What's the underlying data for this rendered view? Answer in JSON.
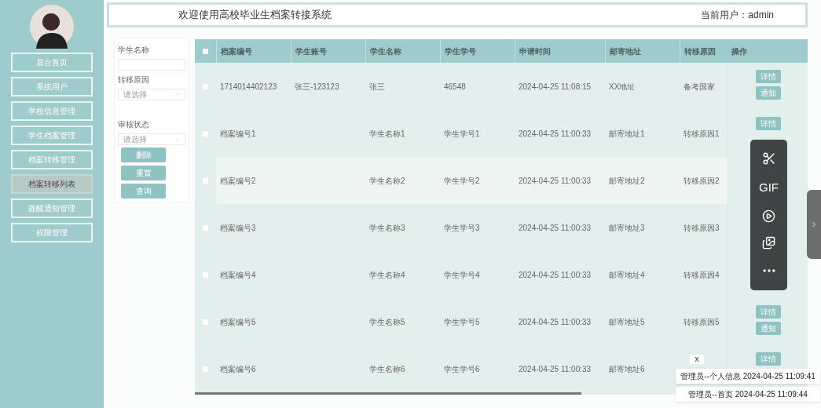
{
  "sidebar": {
    "items": [
      {
        "label": "后台首页",
        "selected": false
      },
      {
        "label": "系统用户",
        "selected": false
      },
      {
        "label": "学校信息管理",
        "selected": false
      },
      {
        "label": "学生档案管理",
        "selected": false
      },
      {
        "label": "档案转移管理",
        "selected": false
      },
      {
        "label": "档案转移列表",
        "selected": true
      },
      {
        "label": "提醒通知管理",
        "selected": false
      },
      {
        "label": "权限管理",
        "selected": false
      }
    ]
  },
  "header": {
    "title": "欢迎使用高校毕业生档案转接系统",
    "user": "当前用户：admin"
  },
  "filters": {
    "fields": [
      {
        "kind": "input",
        "label": "学生名称"
      },
      {
        "kind": "select",
        "label": "转移原因",
        "placeholder": "请选择"
      },
      {
        "kind": "select",
        "label": "审核状态",
        "placeholder": "请选择"
      }
    ],
    "buttons": [
      "删除",
      "重置",
      "查询"
    ]
  },
  "table": {
    "header_checked": false,
    "columns": [
      "档案编号",
      "学生账号",
      "学生名称",
      "学生学号",
      "申请时间",
      "邮寄地址",
      "转移原因",
      "操作"
    ],
    "rows": [
      {
        "checked": false,
        "cells": [
          "1714014402123",
          "张三-123123",
          "张三",
          "46548",
          "2024-04-25 11:08:15",
          "XX地址",
          "备考国家"
        ],
        "actions": [
          "详情",
          "通知"
        ]
      },
      {
        "checked": false,
        "cells": [
          "档案编号1",
          "",
          "学生名称1",
          "学生学号1",
          "2024-04-25 11:00:33",
          "邮寄地址1",
          "转移原因1"
        ],
        "actions": [
          "详情"
        ]
      },
      {
        "checked": false,
        "cells": [
          "档案编号2",
          "",
          "学生名称2",
          "学生学号2",
          "2024-04-25 11:00:33",
          "邮寄地址2",
          "转移原因2"
        ]
      },
      {
        "checked": false,
        "cells": [
          "档案编号3",
          "",
          "学生名称3",
          "学生学号3",
          "2024-04-25 11:00:33",
          "邮寄地址3",
          "转移原因3"
        ]
      },
      {
        "checked": false,
        "cells": [
          "档案编号4",
          "",
          "学生名称4",
          "学生学号4",
          "2024-04-25 11:00:33",
          "邮寄地址4",
          "转移原因4"
        ]
      },
      {
        "checked": false,
        "cells": [
          "档案编号5",
          "",
          "学生名称5",
          "学生学号5",
          "2024-04-25 11:00:33",
          "邮寄地址5",
          "转移原因5"
        ],
        "actions": [
          "详情",
          "通知"
        ]
      },
      {
        "checked": false,
        "cells": [
          "档案编号6",
          "",
          "学生名称6",
          "学生学号6",
          "2024-04-25 11:00:33",
          "邮寄地址6"
        ],
        "actions": [
          "详情"
        ]
      }
    ]
  },
  "capture_toolbar": {
    "gif_label": "GIF"
  },
  "notifications": {
    "close": "x",
    "items": [
      "管理员--个人信息 2024-04-25 11:09:41",
      "管理员--首页 2024-04-25 11:09:44"
    ]
  }
}
